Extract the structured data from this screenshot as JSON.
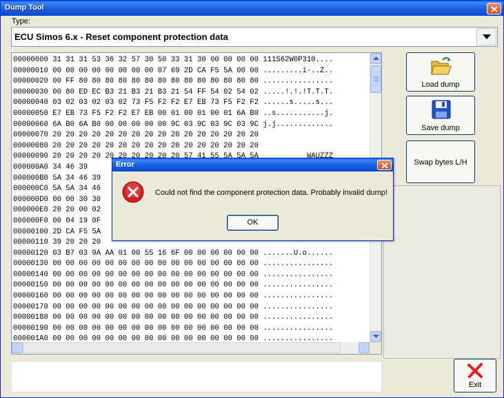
{
  "window": {
    "title": "Dump Tool"
  },
  "type_selector": {
    "label": "Type:",
    "value": "ECU Simos 6.x - Reset component protection data"
  },
  "hex_dump": {
    "lines": [
      "00000000 31 31 31 53 36 32 57 30 50 33 31 30 00 00 00 00 111S62W0P310....",
      "00000010 00 00 00 00 00 00 00 00 07 69 2D CA F5 5A 00 00 .........i-..Z..",
      "00000020 00 FF 80 80 80 80 80 80 80 80 80 80 80 80 80 80 ................",
      "00000030 00 80 ED EC B3 21 B3 21 B3 21 54 FF 54 02 54 02 .....!.!.!T.T.T.",
      "00000040 03 02 03 02 03 02 73 F5 F2 F2 E7 EB 73 F5 F2 F2 ......s.....s...",
      "00000050 E7 EB 73 F5 F2 F2 E7 EB 00 01 00 01 00 01 6A B0 ..s...........j.",
      "00000060 6A B0 6A B0 00 00 00 00 00 9C 03 9C 03 9C 03 9C j.j.............",
      "00000070 20 20 20 20 20 20 20 20 20 20 20 20 20 20 20 20                 ",
      "00000080 20 20 20 20 20 20 20 20 20 20 20 20 20 20 20 20                 ",
      "00000090 20 20 20 20 20 20 20 20 20 20 57 41 55 5A 5A 5A           WAUZZZ",
      "000000A0 34 46 39",
      "000000B0 5A 34 46 39",
      "000000C0 5A 5A 34 46",
      "000000D0 00 00 30 30",
      "000000E0 20 20 00 02",
      "000000F0 00 04 19 0F",
      "00000100 2D CA F5 5A",
      "00000110 39 20 20 20",
      "00000120 03 B7 03 9A AA 01 00 55 16 6F 00 00 00 00 00 00 .......U.o......",
      "00000130 00 00 00 00 00 00 00 00 00 00 00 00 00 00 00 00 ................",
      "00000140 00 00 00 00 00 00 00 00 00 00 00 00 00 00 00 00 ................",
      "00000150 00 00 00 00 00 00 00 00 00 00 00 00 00 00 00 00 ................",
      "00000160 00 00 00 00 00 00 00 00 00 00 00 00 00 00 00 00 ................",
      "00000170 00 00 00 00 00 00 00 00 00 00 00 00 00 00 00 00 ................",
      "00000180 00 00 00 00 00 00 00 00 00 00 00 00 00 00 00 00 ................",
      "00000190 00 00 00 00 00 00 00 00 00 00 00 00 00 00 00 00 ................",
      "000001A0 00 00 00 00 00 00 00 00 00 00 00 00 00 00 00 00 ................"
    ]
  },
  "buttons": {
    "load": "Load dump",
    "save": "Save dump",
    "swap": "Swap bytes L/H",
    "exit": "Exit"
  },
  "error_dialog": {
    "title": "Error",
    "message": "Could not find the component protection data. Probably invalid dump!",
    "ok": "OK"
  },
  "colors": {
    "titlebar": "#0a5fdb",
    "window_bg": "#ece9d8",
    "close_button": "#cf4a22",
    "error_icon": "#d11f1f",
    "save_icon": "#1f52c9",
    "load_icon": "#f4d35e",
    "exit_icon": "#e02020"
  },
  "icons": [
    "close-icon",
    "dropdown-arrow-icon",
    "open-folder-icon",
    "floppy-disk-icon",
    "exit-x-icon",
    "error-icon"
  ]
}
